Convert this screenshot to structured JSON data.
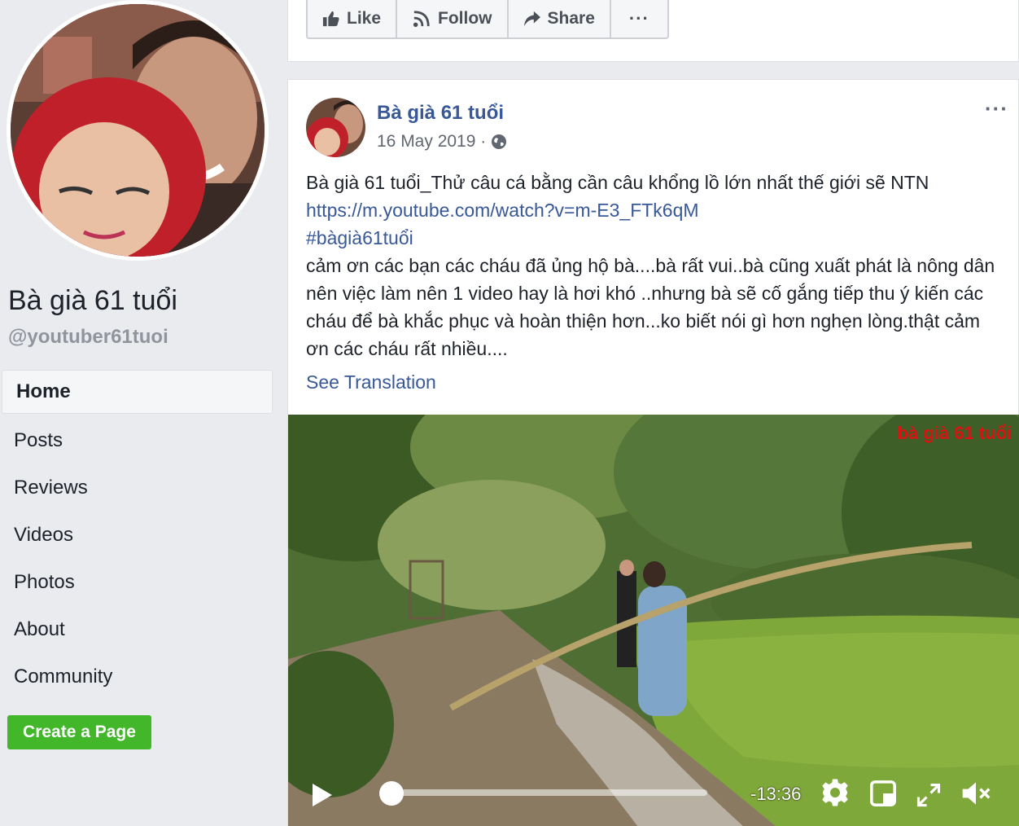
{
  "page": {
    "name": "Bà già 61 tuổi",
    "handle": "@youtuber61tuoi"
  },
  "nav": {
    "items": [
      {
        "label": "Home"
      },
      {
        "label": "Posts"
      },
      {
        "label": "Reviews"
      },
      {
        "label": "Videos"
      },
      {
        "label": "Photos"
      },
      {
        "label": "About"
      },
      {
        "label": "Community"
      }
    ],
    "active": "Home"
  },
  "create_page_label": "Create a Page",
  "actions": {
    "like": "Like",
    "follow": "Follow",
    "share": "Share",
    "more": "···"
  },
  "post": {
    "author": "Bà già 61 tuổi",
    "date": "16 May 2019 ·",
    "more": "···",
    "text_line1": "Bà già 61 tuổi_Thử câu cá bằng cần câu khổng lồ lớn nhất thế giới sẽ NTN",
    "link": "https://m.youtube.com/watch?v=m-E3_FTk6qM",
    "hashtag": "#bàgià61tuổi",
    "paragraph": "cảm ơn các bạn các cháu đã ủng hộ bà....bà rất vui..bà cũng xuất phát là nông dân nên việc làm nên 1 video hay là hơi khó ..nhưng bà sẽ cố gắng tiếp thu ý kiến các cháu để bà khắc phục và hoàn thiện hơn...ko biết nói gì hơn nghẹn lòng.thật cảm ơn các cháu rất nhiều....",
    "see_translation": "See Translation"
  },
  "video": {
    "watermark": "bà già 61 tuổi",
    "time_remaining": "-13:36",
    "progress": 0.0
  },
  "icons": {
    "like": "thumbs-up-icon",
    "follow": "rss-icon",
    "share": "share-arrow-icon",
    "privacy": "globe-icon",
    "play": "play-icon",
    "settings": "gear-icon",
    "pip": "picture-in-picture-icon",
    "fullscreen": "fullscreen-icon",
    "volume": "muted-speaker-icon"
  },
  "colors": {
    "link": "#385898",
    "create_button": "#42b72a",
    "background": "#e9ebee"
  }
}
